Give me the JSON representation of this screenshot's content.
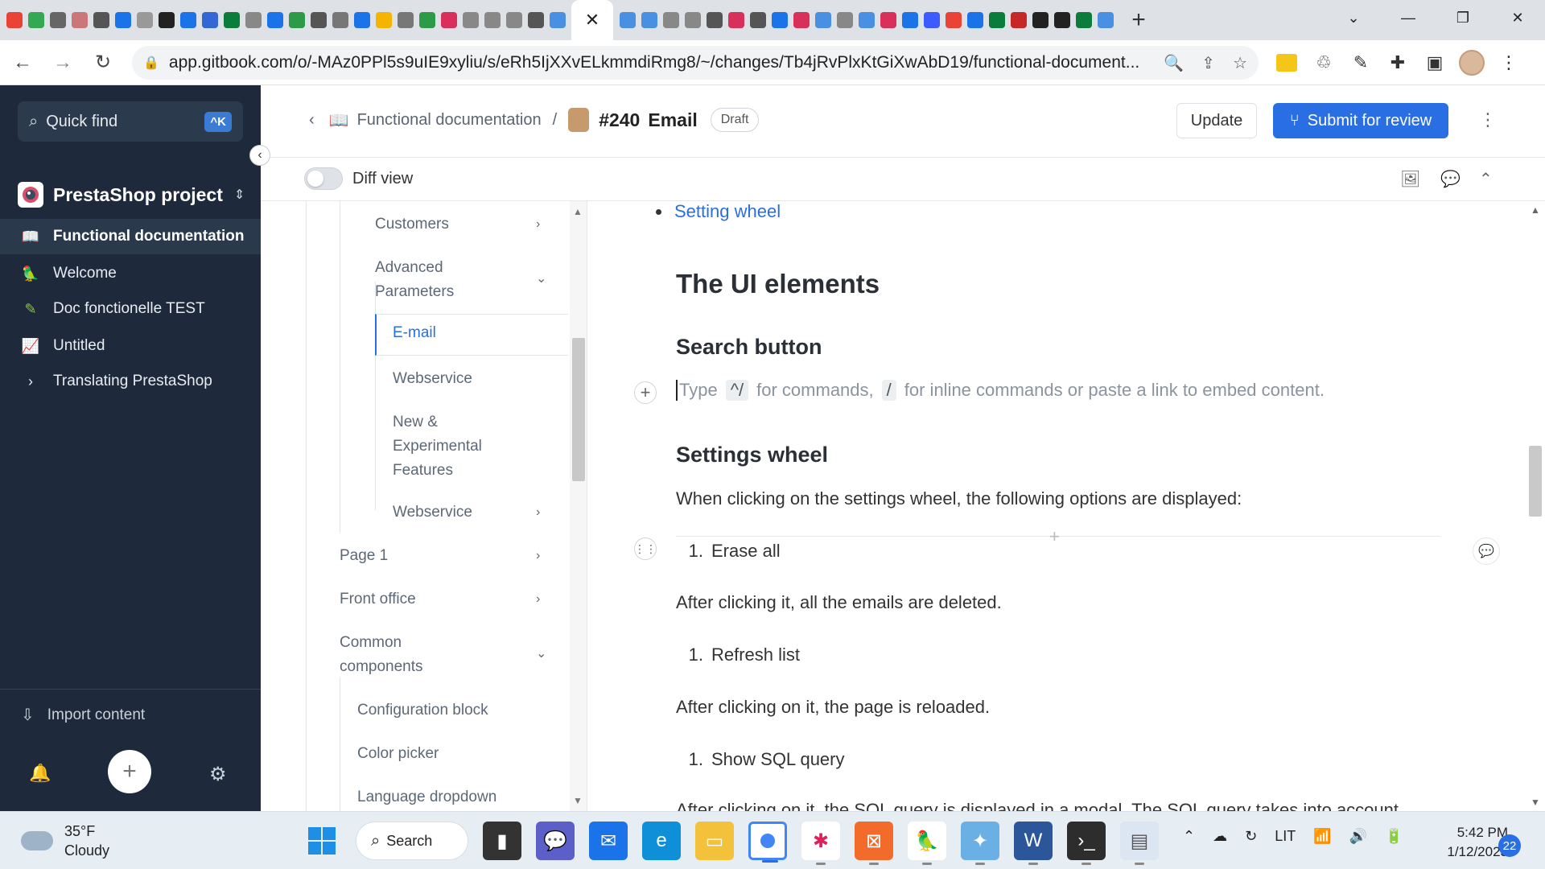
{
  "browser": {
    "tab_count_visible": 52,
    "active_tab_close": "✕",
    "new_tab": "+",
    "url": "app.gitbook.com/o/-MAz0PPl5s9uIE9xyliu/s/eRh5IjXXvELkmmdiRmg8/~/changes/Tb4jRvPlxKtGiXwAbD19/functional-document...",
    "colors": {
      "tabstrip": "#dee1e6",
      "omnibox": "#f1f3f4"
    }
  },
  "sidebar": {
    "search": {
      "label": "Quick find",
      "shortcut": "^K"
    },
    "project": {
      "name": "PrestaShop project"
    },
    "items": [
      {
        "label": "Functional documentation",
        "icon": "book-icon",
        "active": true
      },
      {
        "label": "Welcome",
        "icon": "parrot-icon"
      },
      {
        "label": "Doc fonctionelle TEST",
        "icon": "pencil-icon"
      },
      {
        "label": "Untitled",
        "icon": "chart-icon"
      },
      {
        "label": "Translating PrestaShop",
        "icon": "chevron-right-icon"
      }
    ],
    "import_label": "Import content",
    "colors": {
      "bg": "#1e2a3b",
      "active": "#2b394c"
    }
  },
  "header": {
    "breadcrumb_space": "Functional documentation",
    "change_number": "#240",
    "change_title": "Email",
    "status_badge": "Draft",
    "update_label": "Update",
    "submit_label": "Submit for review",
    "accent": "#2a6ee3"
  },
  "toolbar": {
    "diff_label": "Diff view",
    "diff_on": false
  },
  "tree": {
    "items": [
      {
        "label": "Customers",
        "chev": "›"
      },
      {
        "label": "Advanced Parameters",
        "chev": "⌄"
      },
      {
        "label": "E-mail",
        "active": true
      },
      {
        "label": "Webservice"
      },
      {
        "label": "New & Experimental Features"
      },
      {
        "label": "Webservice",
        "chev": "›"
      },
      {
        "label": "Page 1",
        "chev": "›"
      },
      {
        "label": "Front office",
        "chev": "›"
      },
      {
        "label": "Common components",
        "chev": "⌄"
      },
      {
        "label": "Configuration block"
      },
      {
        "label": "Color picker"
      },
      {
        "label": "Language dropdown"
      }
    ]
  },
  "editor": {
    "bullet_link": "Setting wheel",
    "heading_ui": "The UI elements",
    "heading_search": "Search button",
    "placeholder": {
      "a": "Type",
      "kb1": "^/",
      "b": "for commands,",
      "kb2": "/",
      "c": "for inline commands or paste a link to embed content."
    },
    "heading_settings": "Settings wheel",
    "intro": "When clicking on the settings wheel, the following options are displayed:",
    "list": [
      {
        "n": "1.",
        "text": "Erase all",
        "after": "After clicking it, all the emails are deleted."
      },
      {
        "n": "1.",
        "text": "Refresh list",
        "after": "After clicking on it, the page is reloaded."
      },
      {
        "n": "1.",
        "text": "Show SQL query",
        "after": "After clicking on it, the SQL query is displayed in a modal. The SQL query takes into account"
      }
    ]
  },
  "taskbar": {
    "weather_temp": "35°F",
    "weather_desc": "Cloudy",
    "search_label": "Search",
    "tray_lang": "LIT",
    "time": "5:42 PM",
    "date": "1/12/2023",
    "notifications": "22"
  }
}
